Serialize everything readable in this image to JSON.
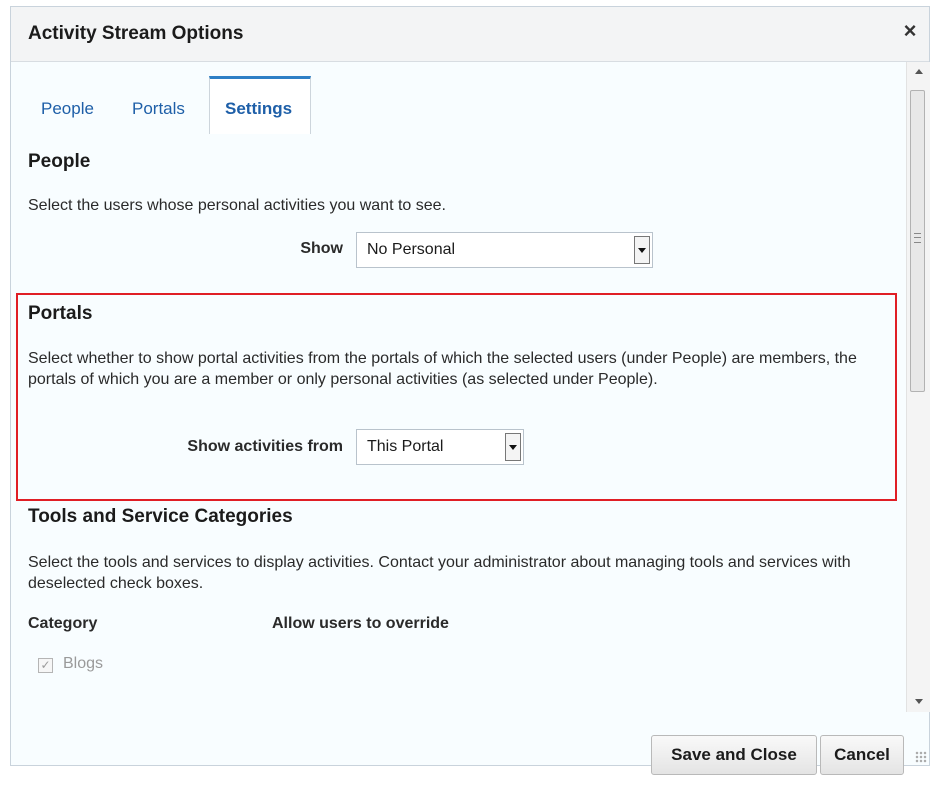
{
  "dialog": {
    "title": "Activity Stream Options",
    "close_icon": "×"
  },
  "tabs": [
    {
      "label": "People"
    },
    {
      "label": "Portals"
    },
    {
      "label": "Settings",
      "active": true
    }
  ],
  "people_section": {
    "heading": "People",
    "description": "Select the users whose personal activities you want to see.",
    "show_label": "Show",
    "show_value": "No Personal"
  },
  "portals_section": {
    "heading": "Portals",
    "description": "Select whether to show portal activities from the portals of which the selected users (under People) are members, the portals of which you are a member or only personal activities (as selected under People).",
    "show_label": "Show activities from",
    "show_value": "This Portal"
  },
  "tools_section": {
    "heading": "Tools and Service Categories",
    "description": "Select the tools and services to display activities. Contact your administrator about managing tools and services with deselected check boxes.",
    "col_category": "Category",
    "col_override": "Allow users to override",
    "items": [
      {
        "label": "Blogs",
        "checked": true,
        "disabled": true
      }
    ]
  },
  "footer": {
    "save_close_label": "Save and Close",
    "cancel_label": "Cancel"
  },
  "colors": {
    "accent": "#2d7fc6",
    "highlight_border": "#e01e25",
    "link": "#1e5fa8"
  }
}
